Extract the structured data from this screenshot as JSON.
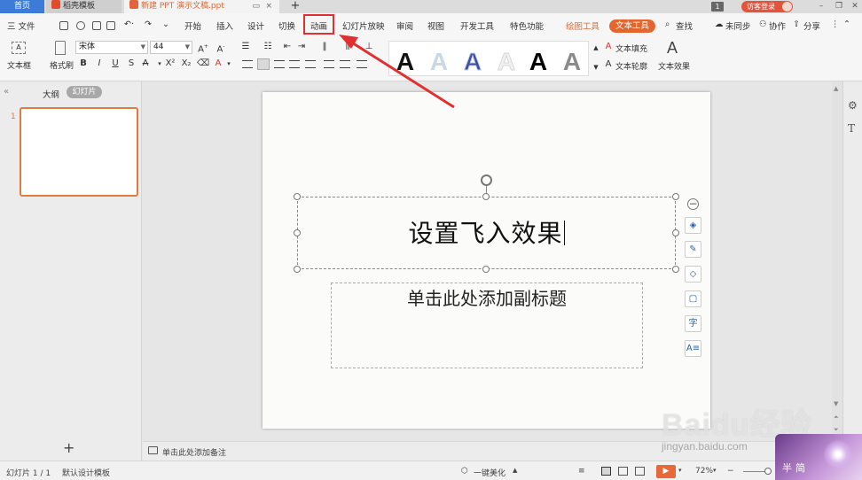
{
  "titlebar": {
    "home_tab": "首页",
    "daoke_tab": "稻壳模板",
    "doc_tab": "新建 PPT 演示文稿.ppt",
    "new_tab_symbol": "+",
    "page_badge": "1",
    "guest_login": "访客登录"
  },
  "menubar": {
    "file": "三 文件",
    "items": [
      "开始",
      "插入",
      "设计",
      "切换",
      "动画",
      "幻灯片放映",
      "审阅",
      "视图",
      "开发工具",
      "特色功能"
    ],
    "drawing_tools": "绘图工具",
    "text_tools": "文本工具",
    "search": "查找",
    "unsynced": "未同步",
    "collaborate": "协作",
    "share": "分享"
  },
  "ribbon": {
    "textbox_label": "文本框",
    "format_painter": "格式刷",
    "font_name": "宋体",
    "font_size": "44",
    "text_fill": "文本填充",
    "text_outline": "文本轮廓",
    "text_effect": "文本效果"
  },
  "left_panel": {
    "outline_tab": "大纲",
    "slides_tab": "幻灯片",
    "slide_number": "1",
    "add_slide": "+"
  },
  "slide": {
    "title": "设置飞入效果",
    "subtitle": "单击此处添加副标题"
  },
  "notes": {
    "placeholder": "单击此处添加备注"
  },
  "statusbar": {
    "slide_count": "幻灯片 1 / 1",
    "template": "默认设计模板",
    "beautify": "一键美化",
    "zoom": "72%"
  },
  "watermark": {
    "brand": "Baidu经验",
    "url": "jingyan.baidu.com",
    "badge_text": "半简"
  },
  "colors": {
    "accent_orange": "#e4662c",
    "annotation_red": "#e03030",
    "tab_blue": "#3d7bd8"
  }
}
